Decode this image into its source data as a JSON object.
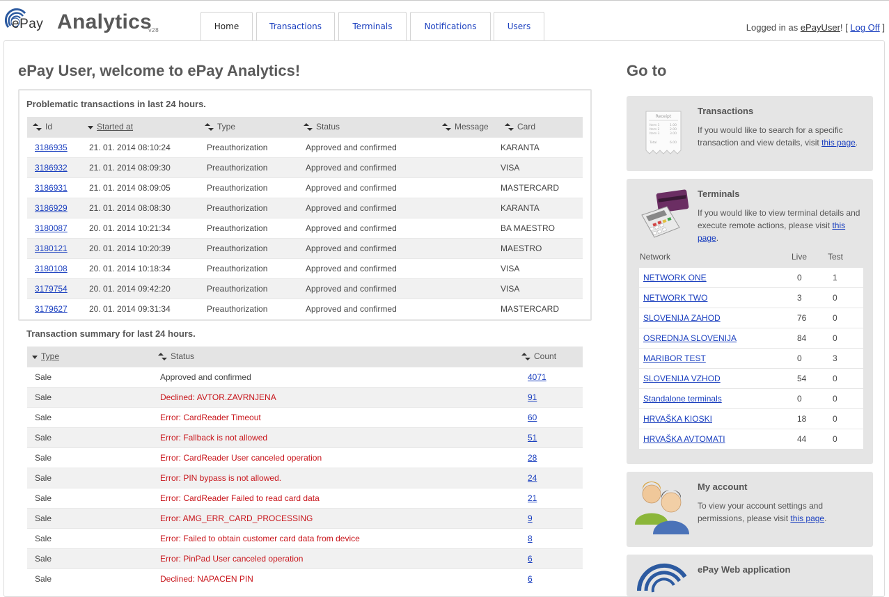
{
  "header": {
    "logo_text": "ePay",
    "app_title": "Analytics",
    "version": "v28",
    "tabs": [
      {
        "label": "Home"
      },
      {
        "label": "Transactions"
      },
      {
        "label": "Terminals"
      },
      {
        "label": "Notifications"
      },
      {
        "label": "Users"
      }
    ],
    "login_prefix": "Logged in as ",
    "login_user": "ePayUser",
    "login_mid": "! [ ",
    "logoff_label": "Log Off",
    "login_suffix": " ]"
  },
  "main": {
    "welcome": "ePay User, welcome to ePay Analytics!",
    "problematic": {
      "title": "Problematic transactions in last 24 hours.",
      "columns": [
        "Id",
        "Started at",
        "Type",
        "Status",
        "Message",
        "Card"
      ],
      "rows": [
        {
          "id": "3186935",
          "started": "21. 01. 2014 08:10:24",
          "type": "Preauthorization",
          "status": "Approved and confirmed",
          "message": "",
          "card": "KARANTA"
        },
        {
          "id": "3186932",
          "started": "21. 01. 2014 08:09:30",
          "type": "Preauthorization",
          "status": "Approved and confirmed",
          "message": "",
          "card": "VISA"
        },
        {
          "id": "3186931",
          "started": "21. 01. 2014 08:09:05",
          "type": "Preauthorization",
          "status": "Approved and confirmed",
          "message": "",
          "card": "MASTERCARD"
        },
        {
          "id": "3186929",
          "started": "21. 01. 2014 08:08:30",
          "type": "Preauthorization",
          "status": "Approved and confirmed",
          "message": "",
          "card": "KARANTA"
        },
        {
          "id": "3180087",
          "started": "20. 01. 2014 10:21:34",
          "type": "Preauthorization",
          "status": "Approved and confirmed",
          "message": "",
          "card": "BA MAESTRO"
        },
        {
          "id": "3180121",
          "started": "20. 01. 2014 10:20:39",
          "type": "Preauthorization",
          "status": "Approved and confirmed",
          "message": "",
          "card": "MAESTRO"
        },
        {
          "id": "3180108",
          "started": "20. 01. 2014 10:18:34",
          "type": "Preauthorization",
          "status": "Approved and confirmed",
          "message": "",
          "card": "VISA"
        },
        {
          "id": "3179754",
          "started": "20. 01. 2014 09:42:20",
          "type": "Preauthorization",
          "status": "Approved and confirmed",
          "message": "",
          "card": "VISA"
        },
        {
          "id": "3179627",
          "started": "20. 01. 2014 09:31:34",
          "type": "Preauthorization",
          "status": "Approved and confirmed",
          "message": "",
          "card": "MASTERCARD"
        }
      ]
    },
    "summary": {
      "title": "Transaction summary for last 24 hours.",
      "columns": [
        "Type",
        "Status",
        "Count"
      ],
      "rows": [
        {
          "type": "Sale",
          "status": "Approved and confirmed",
          "count": "4071",
          "error": false
        },
        {
          "type": "Sale",
          "status": "Declined: AVTOR.ZAVRNJENA",
          "count": "91",
          "error": true
        },
        {
          "type": "Sale",
          "status": "Error: CardReader Timeout",
          "count": "60",
          "error": true
        },
        {
          "type": "Sale",
          "status": "Error: Fallback is not allowed",
          "count": "51",
          "error": true
        },
        {
          "type": "Sale",
          "status": "Error: CardReader User canceled operation",
          "count": "28",
          "error": true
        },
        {
          "type": "Sale",
          "status": "Error: PIN bypass is not allowed.",
          "count": "24",
          "error": true
        },
        {
          "type": "Sale",
          "status": "Error: CardReader Failed to read card data",
          "count": "21",
          "error": true
        },
        {
          "type": "Sale",
          "status": "Error: AMG_ERR_CARD_PROCESSING",
          "count": "9",
          "error": true
        },
        {
          "type": "Sale",
          "status": "Error: Failed to obtain customer card data from device",
          "count": "8",
          "error": true
        },
        {
          "type": "Sale",
          "status": "Error: PinPad User canceled operation",
          "count": "6",
          "error": true
        },
        {
          "type": "Sale",
          "status": "Declined: NAPACEN PIN",
          "count": "6",
          "error": true
        }
      ]
    }
  },
  "goto": {
    "title": "Go to",
    "transactions": {
      "title": "Transactions",
      "text": "If you would like to search for a specific transaction and view details, visit ",
      "link": "this page",
      "suffix": ".",
      "receipt_title": "Receipt",
      "receipt_lines": [
        "Item 1",
        "Item 2",
        "Item 3",
        "Total"
      ],
      "receipt_values": [
        "1.00",
        "2.00",
        "3.00",
        "6.00"
      ]
    },
    "terminals": {
      "title": "Terminals",
      "text": "If you would like to view terminal details and execute remote actions, please visit ",
      "link": "this page",
      "suffix": ".",
      "columns": [
        "Network",
        "Live",
        "Test"
      ],
      "rows": [
        {
          "network": "NETWORK ONE",
          "live": "0",
          "test": "1"
        },
        {
          "network": "NETWORK TWO",
          "live": "3",
          "test": "0"
        },
        {
          "network": "SLOVENIJA ZAHOD",
          "live": "76",
          "test": "0"
        },
        {
          "network": "OSREDNJA SLOVENIJA",
          "live": "84",
          "test": "0"
        },
        {
          "network": "MARIBOR TEST",
          "live": "0",
          "test": "3"
        },
        {
          "network": "SLOVENIJA VZHOD",
          "live": "54",
          "test": "0"
        },
        {
          "network": "Standalone terminals",
          "live": "0",
          "test": "0"
        },
        {
          "network": "HRVAŠKA KIOSKI",
          "live": "18",
          "test": "0"
        },
        {
          "network": "HRVAŠKA AVTOMATI",
          "live": "44",
          "test": "0"
        }
      ]
    },
    "account": {
      "title": "My account",
      "text": "To view your account settings and permissions, please visit ",
      "link": "this page",
      "suffix": "."
    },
    "webapp": {
      "title": "ePay Web application"
    }
  },
  "colors": {
    "link": "#1a3fbf",
    "error": "#c8151b",
    "header_bg": "#e4e4e4",
    "box_bg": "#e5e5e5"
  }
}
